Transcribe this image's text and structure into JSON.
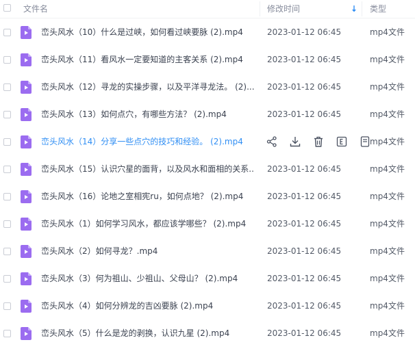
{
  "header": {
    "name_label": "文件名",
    "time_label": "修改时间",
    "type_label": "类型"
  },
  "colors": {
    "link": "#2f8ef4",
    "icon_purple": "#9b6cf0"
  },
  "rows": [
    {
      "name": "峦头风水（10）什么是过峡，如何看过峡要脉 (2).mp4",
      "time": "2023-01-12 06:45",
      "type": "mp4文件"
    },
    {
      "name": "峦头风水（11）看风水一定要知道的主客关系 (2).mp4",
      "time": "2023-01-12 06:45",
      "type": "mp4文件"
    },
    {
      "name": "峦头风水（12）寻龙的实操步骤，以及平洋寻龙法。 (2)....",
      "time": "2023-01-12 06:45",
      "type": "mp4文件"
    },
    {
      "name": "峦头风水（13）如何点穴，有哪些方法？ (2).mp4",
      "time": "2023-01-12 06:45",
      "type": "mp4文件"
    },
    {
      "name": "峦头风水（14）分享一些点穴的技巧和经验。 (2).mp4",
      "time": "",
      "type": "mp4文件",
      "hover": true
    },
    {
      "name": "峦头风水（15）认识穴星的面背，以及风水和面相的关系...",
      "time": "2023-01-12 06:45",
      "type": "mp4文件"
    },
    {
      "name": "峦头风水（16）论地之室相宪ru，如何点地？ (2).mp4",
      "time": "2023-01-12 06:45",
      "type": "mp4文件"
    },
    {
      "name": "峦头风水（1）如何学习风水，都应该学哪些？ (2).mp4",
      "time": "2023-01-12 06:45",
      "type": "mp4文件"
    },
    {
      "name": "峦头风水（2）如何寻龙？.mp4",
      "time": "2023-01-12 06:45",
      "type": "mp4文件"
    },
    {
      "name": "峦头风水（3）何为祖山、少祖山、父母山？ (2).mp4",
      "time": "2023-01-12 06:45",
      "type": "mp4文件"
    },
    {
      "name": "峦头风水（4）如何分辨龙的吉凶要脉 (2).mp4",
      "time": "2023-01-12 06:45",
      "type": "mp4文件"
    },
    {
      "name": "峦头风水（5）什么是龙的剥换，认识九星 (2).mp4",
      "time": "2023-01-12 06:45",
      "type": "mp4文件"
    }
  ]
}
